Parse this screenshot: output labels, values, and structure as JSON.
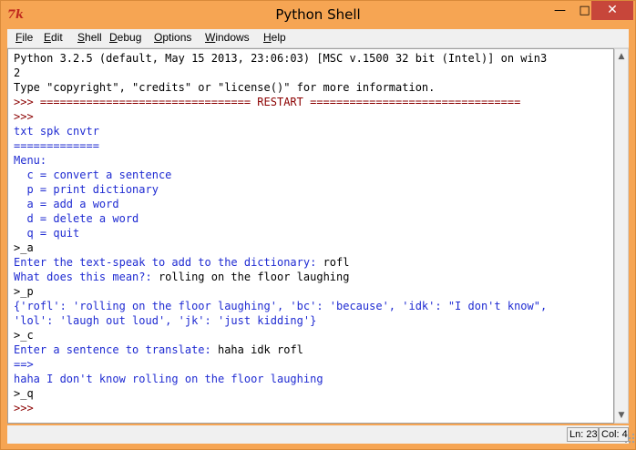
{
  "window": {
    "title": "Python Shell",
    "app_icon": "7k"
  },
  "controls": {
    "minimize_icon": "minimize-icon",
    "maximize_icon": "maximize-icon",
    "close_icon": "close-icon",
    "minimize": "—",
    "maximize": "□",
    "close": "✕"
  },
  "menu": [
    {
      "label": "File",
      "key": "F",
      "rest": "ile"
    },
    {
      "label": "Edit",
      "key": "E",
      "rest": "dit"
    },
    {
      "label": "Shell",
      "key": "S",
      "pre": "",
      "rest": "hell"
    },
    {
      "label": "Debug",
      "key": "D",
      "rest": "ebug"
    },
    {
      "label": "Options",
      "key": "O",
      "rest": "ptions"
    },
    {
      "label": "Windows",
      "key": "W",
      "rest": "indows"
    },
    {
      "label": "Help",
      "key": "H",
      "rest": "elp"
    }
  ],
  "shell_lines": [
    {
      "text": "Python 3.2.5 (default, May 15 2013, 23:06:03) [MSC v.1500 32 bit (Intel)] on win3",
      "kind": "black"
    },
    {
      "text": "2",
      "kind": "black"
    },
    {
      "text": "Type \"copyright\", \"credits\" or \"license()\" for more information.",
      "kind": "black"
    },
    {
      "text": ">>> ================================ RESTART ================================",
      "kind": "prompt"
    },
    {
      "text": ">>>",
      "kind": "prompt"
    },
    {
      "text": "txt spk cnvtr",
      "kind": "blue"
    },
    {
      "text": "=============",
      "kind": "blue"
    },
    {
      "text": "Menu:",
      "kind": "blue"
    },
    {
      "text": "  c = convert a sentence",
      "kind": "blue"
    },
    {
      "text": "  p = print dictionary",
      "kind": "blue"
    },
    {
      "text": "  a = add a word",
      "kind": "blue"
    },
    {
      "text": "  d = delete a word",
      "kind": "blue"
    },
    {
      "text": "  q = quit",
      "kind": "blue"
    },
    {
      "text": ">_a",
      "kind": "black"
    },
    {
      "text": "Enter the text-speak to add to the dictionary: rofl",
      "kind": "mixed",
      "prompt": "Enter the text-speak to add to the dictionary: ",
      "input": "rofl"
    },
    {
      "text": "What does this mean?: rolling on the floor laughing",
      "kind": "mixed",
      "prompt": "What does this mean?: ",
      "input": "rolling on the floor laughing"
    },
    {
      "text": ">_p",
      "kind": "black"
    },
    {
      "text": "{'rofl': 'rolling on the floor laughing', 'bc': 'because', 'idk': \"I don't know\",",
      "kind": "blue"
    },
    {
      "text": "'lol': 'laugh out loud', 'jk': 'just kidding'}",
      "kind": "blue"
    },
    {
      "text": ">_c",
      "kind": "black"
    },
    {
      "text": "Enter a sentence to translate: haha idk rofl",
      "kind": "mixed",
      "prompt": "Enter a sentence to translate: ",
      "input": "haha idk rofl"
    },
    {
      "text": "==>",
      "kind": "blue"
    },
    {
      "text": "haha I don't know rolling on the floor laughing",
      "kind": "blue"
    },
    {
      "text": ">_q",
      "kind": "black"
    },
    {
      "text": ">>>",
      "kind": "prompt"
    }
  ],
  "status": {
    "line": "Ln: 23",
    "col": "Col: 4"
  },
  "colors": {
    "prompt": "#8b0000",
    "output": "#1f2bd2",
    "text": "#000000",
    "titlebar": "#f6a553",
    "close": "#c7463a"
  }
}
